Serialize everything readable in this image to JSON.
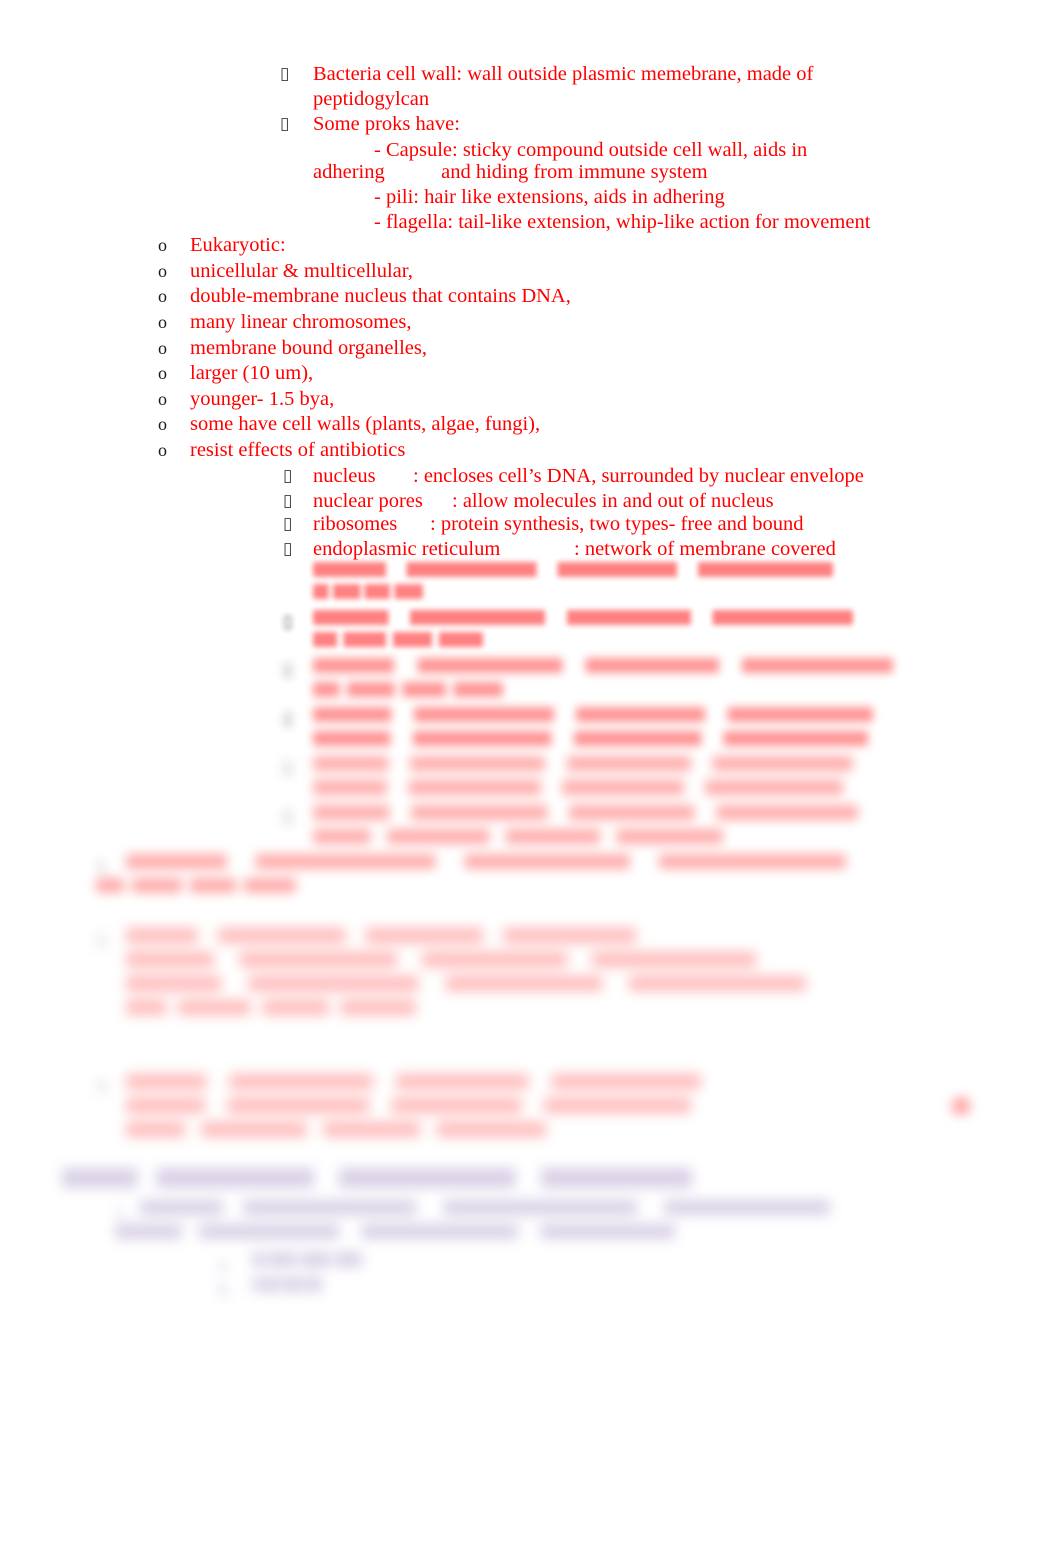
{
  "document": {
    "type": "study-notes",
    "text_color": "#ff0000",
    "heading_color": "#6e4f9e",
    "background": "#ffffff"
  },
  "sharp_section": {
    "prok_bullets": [
      {
        "marker": "tofu-box",
        "lines": [
          "Bacteria cell wall: wall outside plasmic memebrane, made of",
          "peptidogylcan"
        ]
      },
      {
        "marker": "tofu-box",
        "lines": [
          "Some proks have:"
        ]
      }
    ],
    "prok_sublines": [
      "- Capsule: sticky compound outside cell wall, aids in",
      "adhering           and hiding from immune system",
      "- pili: hair like extensions, aids in adhering",
      "- flagella: tail-like extension, whip-like action for movement"
    ],
    "euk_bullets": [
      {
        "marker": "o",
        "label": "Eukaryotic:"
      },
      {
        "marker": "o",
        "label": "unicellular & multicellular,"
      },
      {
        "marker": "o",
        "label": "double-membrane nucleus that contains DNA,"
      },
      {
        "marker": "o",
        "label": "many linear chromosomes,"
      },
      {
        "marker": "o",
        "label": "membrane bound organelles,"
      },
      {
        "marker": "o",
        "label": "larger (10 um),"
      },
      {
        "marker": "o",
        "label": "younger- 1.5 bya,"
      },
      {
        "marker": "o",
        "label": "some have cell walls (plants, algae, fungi),"
      },
      {
        "marker": "o",
        "label": "resist effects of antibiotics"
      }
    ],
    "organelle_bullets": [
      {
        "marker": "tofu-box",
        "term": "nucleus",
        "definition": ": encloses cell’s DNA, surrounded by nuclear envelope"
      },
      {
        "marker": "tofu-box",
        "term": "nuclear pores",
        "definition": ": allow molecules in and out of nucleus"
      },
      {
        "marker": "tofu-box",
        "term": "ribosomes",
        "definition": ": protein synthesis, two types- free and bound"
      },
      {
        "marker": "tofu-box",
        "term": "endoplasmic reticulum",
        "definition": ": network of membrane covered"
      }
    ]
  },
  "blurred_section": {
    "note": "Text below is rendered out of focus in the source screenshot and is not legible.",
    "organelle_continuation": [
      {
        "marker": "tofu-box",
        "lines": [
          "                           ",
          "      "
        ]
      },
      {
        "marker": "tofu-box",
        "lines": [
          "                            ",
          "         "
        ]
      },
      {
        "marker": "tofu-box",
        "lines": [
          "                              ",
          "          "
        ]
      },
      {
        "marker": "tofu-box",
        "lines": [
          "                             ",
          "                             "
        ]
      },
      {
        "marker": "tofu-box",
        "lines": [
          "                           ",
          "                          "
        ]
      },
      {
        "marker": "tofu-box",
        "lines": [
          "                           ",
          "                   "
        ]
      }
    ],
    "question_blocks": [
      {
        "marker": "number",
        "lines": [
          "                                       ",
          "          "
        ]
      },
      {
        "marker": "number",
        "lines": [
          "                       ",
          "                               ",
          "                                 ",
          "              "
        ]
      },
      {
        "marker": "number",
        "lines": [
          "                             ",
          "                            ",
          "                     "
        ]
      }
    ],
    "chapter_heading": "                          ",
    "chapter_items": [
      {
        "marker": "number",
        "lines": [
          "                                   ",
          "                           "
        ]
      }
    ],
    "chapter_subitems": [
      {
        "marker": "letter",
        "text": "         "
      },
      {
        "marker": "letter",
        "text": "     "
      }
    ]
  }
}
